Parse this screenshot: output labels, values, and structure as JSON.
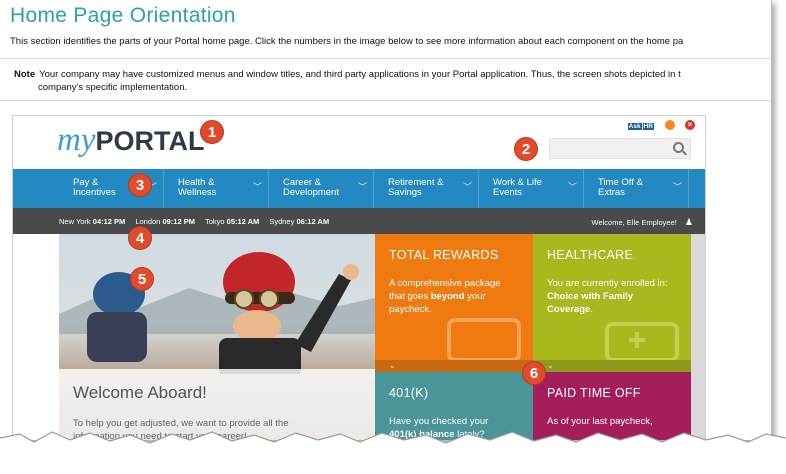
{
  "doc": {
    "title": "Home Page Orientation",
    "intro": "This section identifies the parts of your Portal home page. Click the numbers in the image below to see more information about each component on the home pa",
    "note_label": "Note",
    "note_line1": "Your company may have customized menus and window titles, and third party applications in your Portal application. Thus, the screen shots depicted in t",
    "note_line2": "company's specific implementation."
  },
  "portal": {
    "logo_my": "my",
    "logo_portal": "PORTAL",
    "askhr_badge": "Ask",
    "askhr_text": "HR",
    "close_glyph": "×",
    "search_placeholder": "",
    "nav": [
      {
        "line1": "Pay &",
        "line2": "Incentives"
      },
      {
        "line1": "Health &",
        "line2": "Wellness"
      },
      {
        "line1": "Career &",
        "line2": "Development"
      },
      {
        "line1": "Retirement &",
        "line2": "Savings"
      },
      {
        "line1": "Work & Life",
        "line2": "Events"
      },
      {
        "line1": "Time Off &",
        "line2": "Extras"
      }
    ],
    "chevron": "﹀",
    "clocks": [
      {
        "city": "New York",
        "time": "04:12 PM"
      },
      {
        "city": "London",
        "time": "09:12 PM"
      },
      {
        "city": "Tokyo",
        "time": "05:12 AM"
      },
      {
        "city": "Sydney",
        "time": "06:12 AM"
      }
    ],
    "welcome_user": "Welcome, Elle Employee!",
    "hero": {
      "title": "Welcome Aboard!",
      "body_line1": "To help you get adjusted, we want to provide all the",
      "body_line2": "information you need to start your career!"
    },
    "tiles": {
      "rewards": {
        "title": "TOTAL REWARDS",
        "body_pre": "A comprehensive package that goes ",
        "body_bold": "beyond",
        "body_post": " your paycheck."
      },
      "health": {
        "title": "HEALTHCARE",
        "body_pre": "You are currently enrolled in: ",
        "body_bold": "Choice with Family Coverage",
        "body_post": "."
      },
      "k401": {
        "title": "401(K)",
        "body_pre": "Have you checked your ",
        "body_bold": "401(k) balance",
        "body_post": " lately?"
      },
      "pto": {
        "title": "PAID TIME OFF",
        "body_pre": "As of your last paycheck,",
        "body_bold": "",
        "body_post": ""
      }
    },
    "strip_glyph": "⌄"
  },
  "callouts": [
    "1",
    "2",
    "3",
    "4",
    "5",
    "6"
  ],
  "colors": {
    "title_teal": "#2ba3a3",
    "nav_blue": "#2489c0",
    "time_bar": "#4a4a4a",
    "rewards_orange": "#ee7a10",
    "health_green": "#a8b81d",
    "k401_teal": "#4a9597",
    "pto_magenta": "#a51e5c",
    "callout_red": "#e24a2c"
  }
}
